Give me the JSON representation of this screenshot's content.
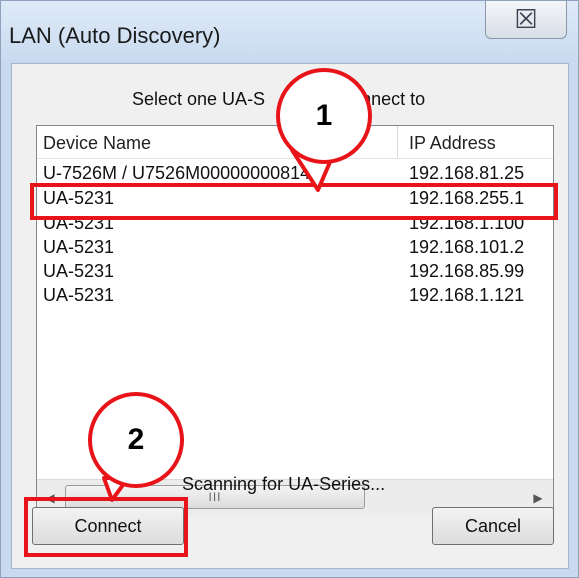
{
  "window": {
    "title": "LAN (Auto Discovery)",
    "close_icon": "close-icon",
    "close_glyph": "☒"
  },
  "dialog": {
    "prompt": "Select one UA-S",
    "prompt_tail": "nnect to",
    "columns": [
      {
        "label": "Device Name"
      },
      {
        "label": "IP Address"
      }
    ],
    "rows": [
      {
        "name": "U-7526M / U7526M00000000814",
        "ip": "192.168.81.25"
      },
      {
        "name": "UA-5231",
        "ip": "192.168.255.1"
      },
      {
        "name": "UA-5231",
        "ip": "192.168.1.100"
      },
      {
        "name": "UA-5231",
        "ip": "192.168.101.2"
      },
      {
        "name": "UA-5231",
        "ip": "192.168.85.99"
      },
      {
        "name": "UA-5231",
        "ip": "192.168.1.121"
      }
    ],
    "scroll_left_glyph": "◀",
    "scroll_right_glyph": "▶",
    "scroll_thumb_glyph": "III",
    "status": "Scanning for UA-Series...",
    "connect_label": "Connect",
    "cancel_label": "Cancel"
  },
  "annotations": {
    "callout_1": "1",
    "callout_2": "2",
    "accent_color": "#e8141a"
  }
}
